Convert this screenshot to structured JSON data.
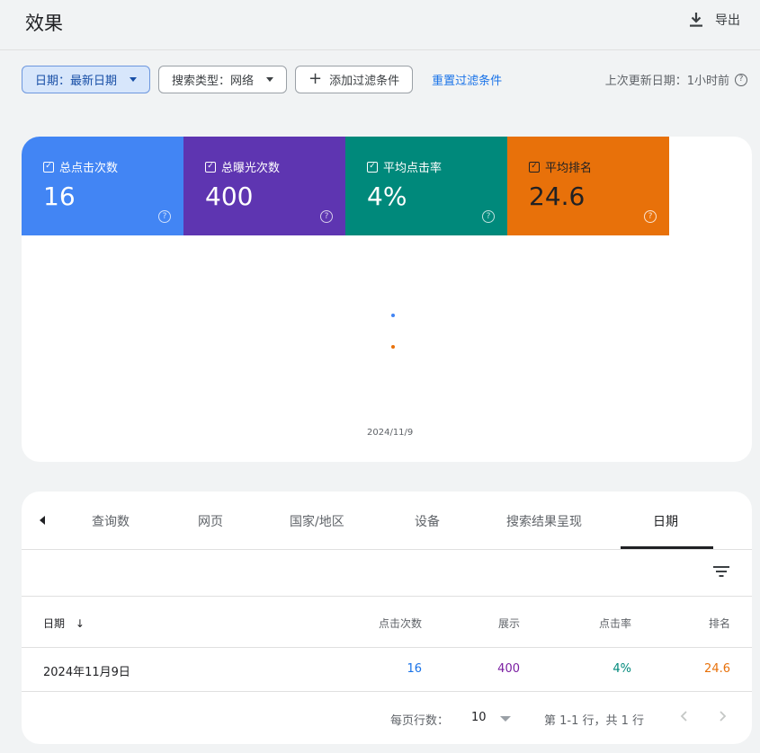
{
  "header": {
    "title": "效果",
    "export_label": "导出"
  },
  "filters": {
    "date_chip": "日期：最新日期",
    "search_type_chip": "搜索类型：网络",
    "add_filter": "添加过滤条件",
    "add_icon": "+",
    "reset": "重置过滤条件",
    "last_update": "上次更新日期：1小时前",
    "help_glyph": "?"
  },
  "metrics": [
    {
      "label": "总点击次数",
      "value": "16",
      "color": "#4285f4"
    },
    {
      "label": "总曝光次数",
      "value": "400",
      "color": "#5e35b1"
    },
    {
      "label": "平均点击率",
      "value": "4%",
      "color": "#00897b"
    },
    {
      "label": "平均排名",
      "value": "24.6",
      "color": "#e8710a"
    }
  ],
  "check_glyph": "✓",
  "chart": {
    "date_label": "2024/11/9",
    "series_colors": {
      "clicks": "#4285f4",
      "position": "#e8710a"
    }
  },
  "tabs": {
    "items": [
      "查询数",
      "网页",
      "国家/地区",
      "设备",
      "搜索结果呈现",
      "日期"
    ],
    "active": "日期"
  },
  "table": {
    "headers": {
      "date": "日期",
      "sort_arrow": "↓",
      "clicks": "点击次数",
      "impressions": "展示",
      "ctr": "点击率",
      "position": "排名"
    },
    "rows": [
      {
        "date": "2024年11月9日",
        "clicks": "16",
        "impressions": "400",
        "ctr": "4%",
        "position": "24.6"
      }
    ],
    "value_colors": {
      "clicks": "#1a73e8",
      "impressions": "#7b1fa2",
      "ctr": "#00897b",
      "position": "#e8710a"
    }
  },
  "pagination": {
    "rows_per_page_label": "每页行数：",
    "rows_per_page_value": "10",
    "range_label": "第 1-1 行，共 1 行"
  }
}
